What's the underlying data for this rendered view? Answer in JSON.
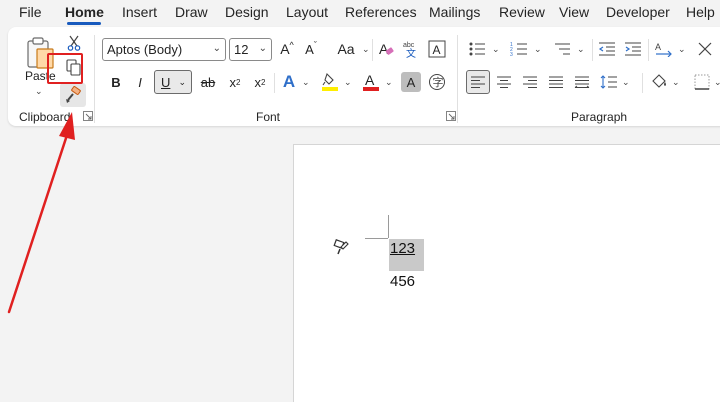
{
  "tabs": [
    "File",
    "Home",
    "Insert",
    "Draw",
    "Design",
    "Layout",
    "References",
    "Mailings",
    "Review",
    "View",
    "Developer",
    "Help"
  ],
  "clipboard": {
    "paste_label": "Paste",
    "group_label": "Clipboard"
  },
  "font": {
    "font_name": "Aptos (Body)",
    "font_size": "12",
    "bold": "B",
    "italic": "I",
    "underline": "U",
    "strike": "ab",
    "subscript": "x",
    "subscript_mark": "2",
    "superscript": "x",
    "superscript_mark": "2",
    "grow": "A",
    "shrink": "A",
    "case": "Aa",
    "clear": "A",
    "text_effects": "A",
    "font_color": "A",
    "shading": "A",
    "group_label": "Font"
  },
  "paragraph": {
    "group_label": "Paragraph"
  },
  "colors": {
    "accent": "#185abd",
    "highlight_yellow": "#ffee00",
    "font_red": "#e02020",
    "annotation_red": "#e02020"
  },
  "document": {
    "line1": "123",
    "line2": "456"
  }
}
